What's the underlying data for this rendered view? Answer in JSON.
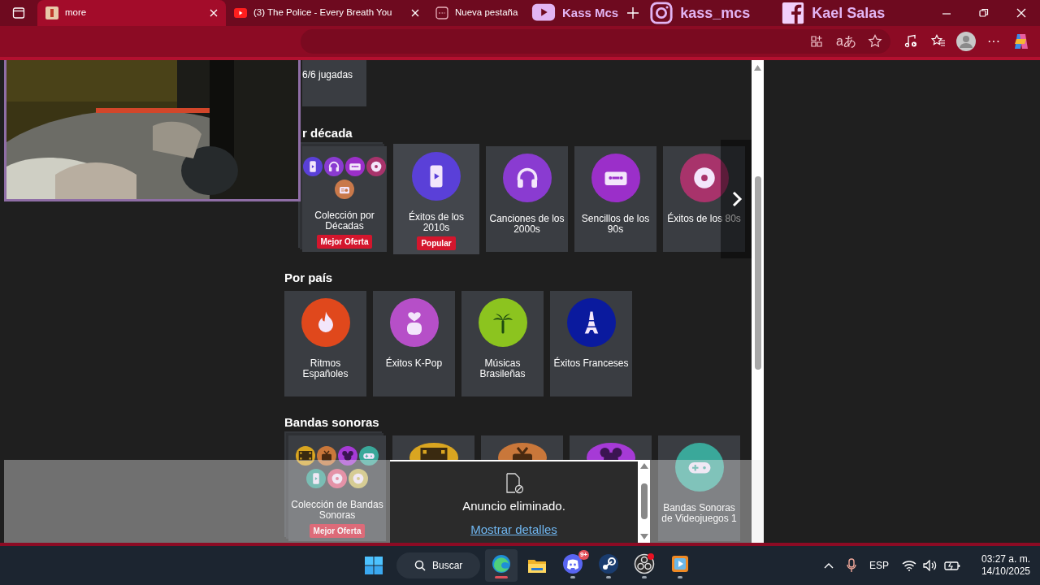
{
  "titlebar": {
    "tabs": [
      {
        "title": "more",
        "selected": true,
        "closable": true
      },
      {
        "title": "(3) The Police - Every Breath You",
        "selected": false,
        "closable": true
      },
      {
        "title": "Nueva pestaña",
        "selected": false,
        "closable": false
      }
    ]
  },
  "stream_overlay": [
    {
      "kind": "youtube",
      "label": "Kass Mcs"
    },
    {
      "kind": "instagram",
      "label": "kass_mcs"
    },
    {
      "kind": "facebook",
      "label": "Kael Salas"
    }
  ],
  "toolbar": {
    "translate_glyph": "aあ",
    "more_glyph": "···"
  },
  "top_card": {
    "text": "6/6 jugadas"
  },
  "sections": [
    {
      "title": "r década",
      "scroll_next": true,
      "cards": [
        {
          "kind": "collection",
          "label": "Colección por Décadas",
          "badge": "Mejor Oferta",
          "hovered": false
        },
        {
          "kind": "single",
          "label": "Éxitos de los 2010s",
          "badge": "Popular",
          "color": "#5a40d8",
          "hovered": true
        },
        {
          "kind": "single",
          "label": "Canciones de los 2000s",
          "color": "#8a3bd1",
          "hovered": false
        },
        {
          "kind": "single",
          "label": "Sencillos de los 90s",
          "color": "#9b2fc9",
          "hovered": false
        },
        {
          "kind": "single",
          "label": "Éxitos de los 80s",
          "color": "#a8336b",
          "hovered": false
        }
      ]
    },
    {
      "title": "Por país",
      "scroll_next": false,
      "cards": [
        {
          "kind": "single",
          "label": "Ritmos Españoles",
          "color": "#e0481c",
          "hovered": false
        },
        {
          "kind": "single",
          "label": "Éxitos K-Pop",
          "color": "#b64fc8",
          "hovered": false
        },
        {
          "kind": "single",
          "label": "Músicas Brasileñas",
          "color": "#8cc41f",
          "hovered": false
        },
        {
          "kind": "single",
          "label": "Éxitos Franceses",
          "color": "#0a1a9e",
          "hovered": false
        }
      ]
    },
    {
      "title": "Bandas sonoras",
      "scroll_next": false,
      "cards": [
        {
          "kind": "collection",
          "label": "Colección de Bandas Sonoras",
          "badge": "Mejor Oferta",
          "hovered": false
        },
        {
          "kind": "single",
          "color": "#d9a520",
          "hovered": false
        },
        {
          "kind": "single",
          "color": "#c9773a",
          "hovered": false
        },
        {
          "kind": "single",
          "color": "#a63ad6",
          "hovered": false
        },
        {
          "kind": "single",
          "label": "Bandas Sonoras de Videojuegos 1",
          "color": "#3aa89a",
          "hovered": false
        }
      ]
    }
  ],
  "ad": {
    "message": "Anuncio eliminado.",
    "link": "Mostrar detalles"
  },
  "taskbar": {
    "search": "Buscar",
    "apps": [
      {
        "active": true,
        "running": true
      },
      {
        "active": false,
        "running": false
      },
      {
        "active": false,
        "running": true,
        "badge": "9+"
      },
      {
        "active": false,
        "running": true
      },
      {
        "active": false,
        "running": true
      },
      {
        "active": false,
        "running": true
      }
    ],
    "language": "ESP",
    "time": "03:27 a. m.",
    "date": "14/10/2025"
  }
}
